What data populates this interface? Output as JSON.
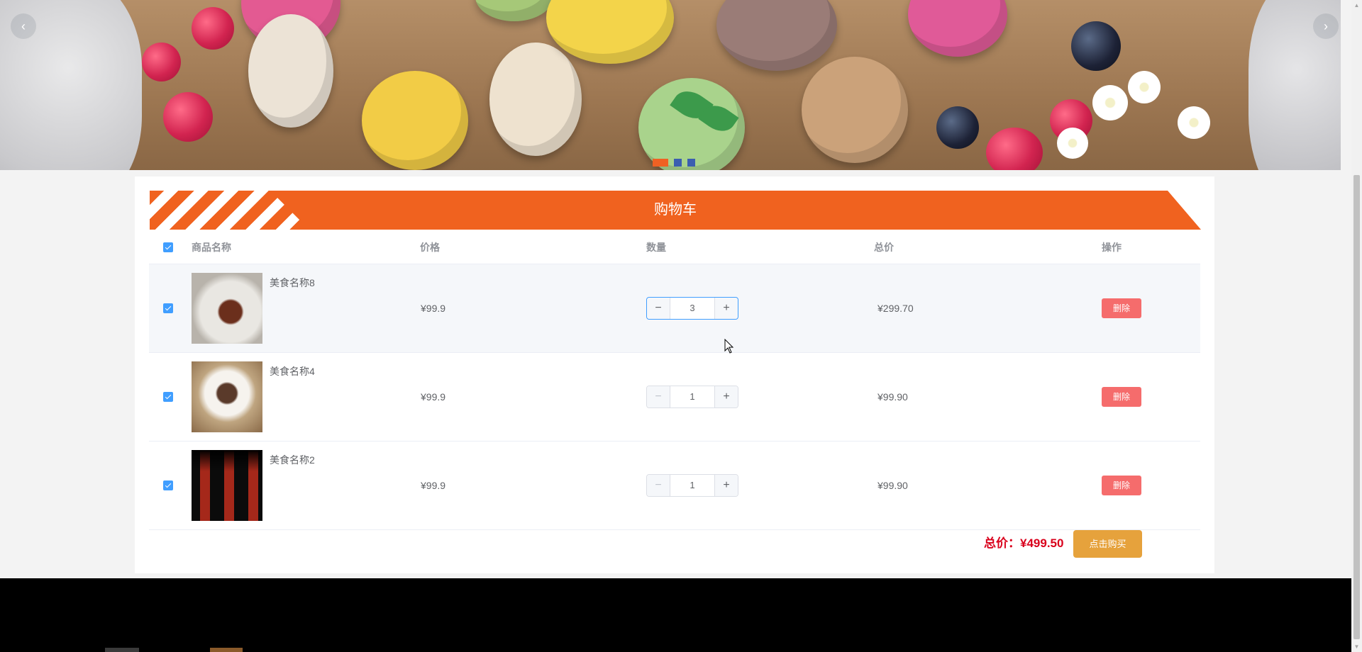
{
  "banner": {
    "prev_icon": "‹",
    "next_icon": "›",
    "slide_count": 3,
    "active_slide": 1
  },
  "cart": {
    "title": "购物车",
    "columns": {
      "name": "商品名称",
      "price": "价格",
      "quantity": "数量",
      "subtotal": "总价",
      "action": "操作"
    },
    "items": [
      {
        "name": "美食名称8",
        "price": "¥99.9",
        "quantity": "3",
        "subtotal": "¥299.70",
        "delete_label": "删除",
        "checked": true
      },
      {
        "name": "美食名称4",
        "price": "¥99.9",
        "quantity": "1",
        "subtotal": "¥99.90",
        "delete_label": "删除",
        "checked": true
      },
      {
        "name": "美食名称2",
        "price": "¥99.9",
        "quantity": "1",
        "subtotal": "¥99.90",
        "delete_label": "删除",
        "checked": true
      }
    ],
    "stepper_minus": "−",
    "stepper_plus": "+",
    "total_text": "总价：¥499.50",
    "buy_label": "点击购买"
  },
  "colors": {
    "accent": "#f0621f",
    "danger": "#f56c6c",
    "warning": "#e6a23c",
    "primary": "#409eff",
    "total_text": "#d9001b"
  },
  "scrollbar": {
    "up": "▲",
    "down": "▼"
  }
}
